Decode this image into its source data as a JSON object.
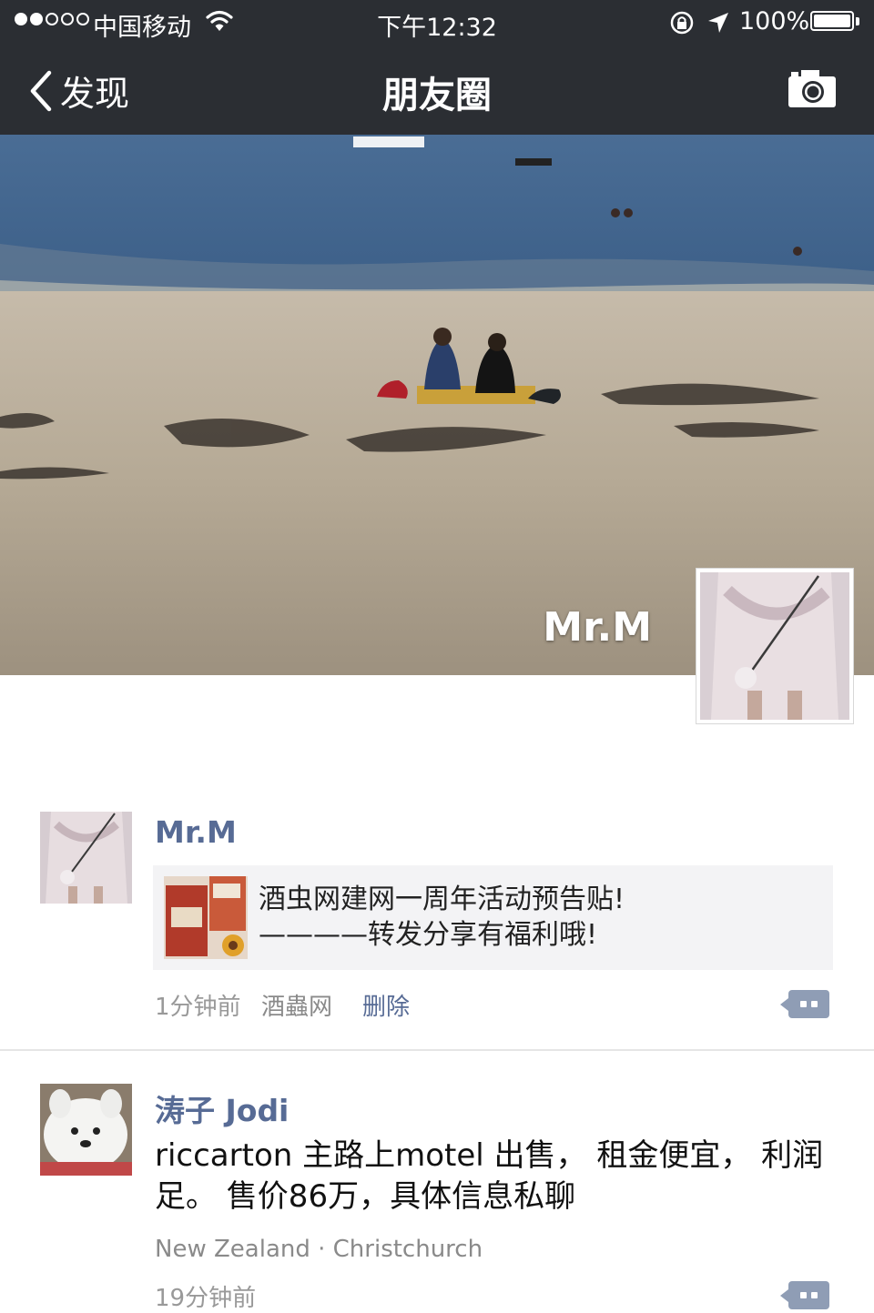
{
  "status_bar": {
    "carrier": "中国移动",
    "time": "下午12:32",
    "battery_percent": "100%",
    "battery_level": 1.0,
    "signal_bars_filled": 2,
    "signal_bars_total": 5
  },
  "nav": {
    "back_label": "发现",
    "title": "朋友圈",
    "right_icon": "camera-icon"
  },
  "cover": {
    "user_name": "Mr.M"
  },
  "posts": [
    {
      "author": "Mr.M",
      "link_card": {
        "line1": "酒虫网建网一周年活动预告贴!",
        "line2": "————转发分享有福利哦!"
      },
      "time": "1分钟前",
      "source": "酒蟲网",
      "delete_label": "删除"
    },
    {
      "author": "涛子 Jodi",
      "text": "riccarton 主路上motel 出售， 租金便宜， 利润足。 售价86万，具体信息私聊",
      "location": "New Zealand · Christchurch",
      "time": "19分钟前"
    }
  ],
  "colors": {
    "nav_bg": "#2b2e33",
    "name_blue": "#576b95",
    "link_card_bg": "#f3f3f5",
    "meta_gray": "#999999"
  }
}
